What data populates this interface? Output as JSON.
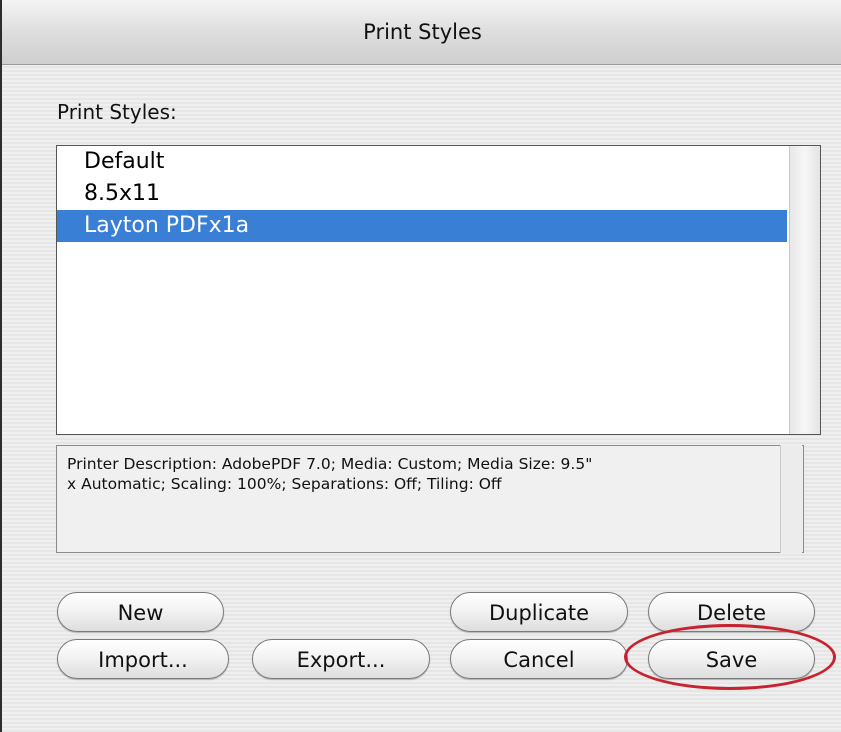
{
  "window": {
    "title": "Print Styles"
  },
  "list": {
    "label": "Print Styles:",
    "items": [
      "Default",
      "8.5x11",
      "Layton PDFx1a"
    ],
    "selected_index": 2
  },
  "description": {
    "line1": "Printer Description: AdobePDF 7.0;  Media: Custom;  Media Size: 9.5\"",
    "line2": "x Automatic;  Scaling: 100%;  Separations: Off;  Tiling: Off"
  },
  "buttons": {
    "new": "New",
    "duplicate": "Duplicate",
    "delete": "Delete",
    "import": "Import...",
    "export": "Export...",
    "cancel": "Cancel",
    "save": "Save"
  },
  "colors": {
    "selection": "#3a7fd6",
    "highlight_ring": "#c8222e"
  }
}
